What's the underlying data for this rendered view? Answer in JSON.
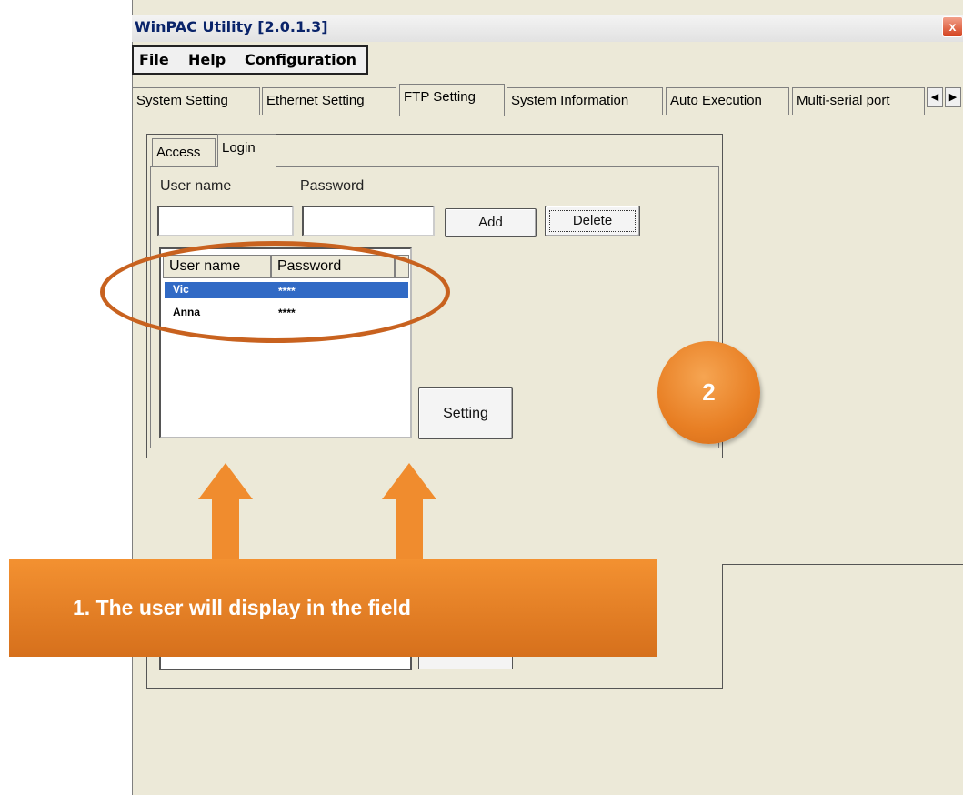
{
  "window": {
    "title": "WinPAC Utility [2.0.1.3]",
    "close_label": "x"
  },
  "menu": [
    "File",
    "Help",
    "Configuration"
  ],
  "tabs": [
    "System Setting",
    "Ethernet Setting",
    "FTP Setting",
    "System Information",
    "Auto Execution",
    "Multi-serial port"
  ],
  "active_tab": "FTP Setting",
  "scroll_buttons": [
    "◀",
    "▶"
  ],
  "inner_tabs": [
    "Access",
    "Login"
  ],
  "form": {
    "username_label": "User name",
    "password_label": "Password",
    "username_value": "",
    "password_value": "",
    "add_label": "Add",
    "delete_label": "Delete",
    "setting_label": "Setting"
  },
  "list": {
    "columns": [
      "User name",
      "Password"
    ],
    "rows": [
      {
        "user": "Vic",
        "password": "****",
        "selected": true
      },
      {
        "user": "Anna",
        "password": "****",
        "selected": false
      }
    ]
  },
  "annotations": {
    "step2": "2",
    "banner": "1. The user will display in the field"
  },
  "colors": {
    "accent_orange": "#f08c2e",
    "selection_blue": "#316ac5"
  }
}
